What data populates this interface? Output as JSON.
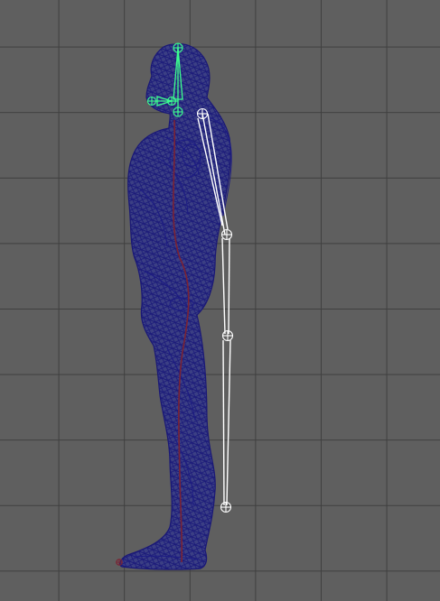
{
  "viewport": {
    "name": "side-view-viewport",
    "background": "#5f5f5f",
    "grid_color": "#3f3f3f"
  },
  "model": {
    "mesh_color": "#1d1c84",
    "skeleton_color": "#ffffff",
    "selected_color": "#3bff8f",
    "spine_color": "#7b2233"
  }
}
